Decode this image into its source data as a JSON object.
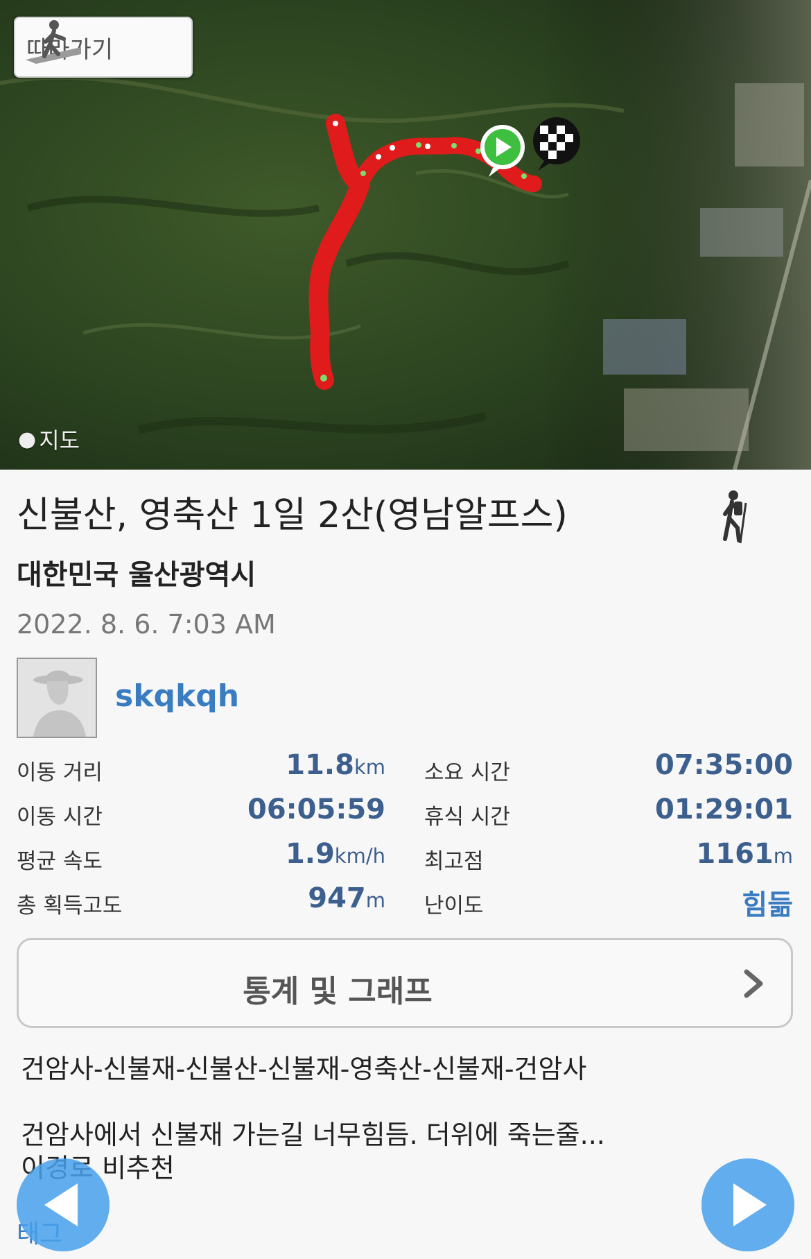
{
  "map": {
    "follow_label": "따라가기",
    "credit_label": "지도"
  },
  "activity": {
    "title": "신불산, 영축산 1일 2산(영남알프스)",
    "location": "대한민국 울산광역시",
    "datetime": "2022. 8. 6. 7:03 AM",
    "username": "skqkqh",
    "activity_icon": "hiker-icon"
  },
  "stats": {
    "distance": {
      "label": "이동 거리",
      "value": "11.8",
      "unit": "km"
    },
    "total_time": {
      "label": "소요 시간",
      "value": "07:35:00",
      "unit": ""
    },
    "moving_time": {
      "label": "이동 시간",
      "value": "06:05:59",
      "unit": ""
    },
    "rest_time": {
      "label": "휴식 시간",
      "value": "01:29:01",
      "unit": ""
    },
    "avg_speed": {
      "label": "평균 속도",
      "value": "1.9",
      "unit": "km/h"
    },
    "max_altitude": {
      "label": "최고점",
      "value": "1161",
      "unit": "m"
    },
    "total_ascent": {
      "label": "총 획득고도",
      "value": "947",
      "unit": "m"
    },
    "difficulty": {
      "label": "난이도",
      "value": "힘듦",
      "unit": ""
    }
  },
  "stats_button": {
    "label": "통계 및 그래프"
  },
  "description": {
    "route": "건암사-신불재-신불산-신불재-영축산-신불재-건암사",
    "memo_line1": "건암사에서 신불재 가는길 너무힘듬. 더위에 죽는줄...",
    "memo_line2": "이경로 비추천",
    "tags_label": "태그"
  },
  "colors": {
    "accent": "#3a7cc2",
    "stat_value": "#3c5f8e",
    "track": "#e01b1b",
    "nav_button": "#46a0eb"
  }
}
